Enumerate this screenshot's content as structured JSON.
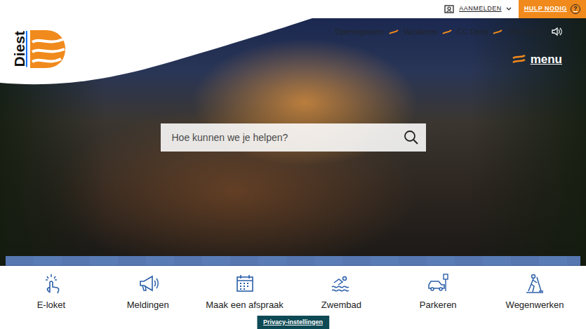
{
  "top_bar": {
    "login": "AANMELDEN",
    "help": "HULP NODIG",
    "help_icon": "?"
  },
  "logo": {
    "text": "Diest"
  },
  "header_links": [
    "Openingsuren",
    "Vacatures",
    "CC Diest",
    "Visit Diest"
  ],
  "menu": {
    "label": "menu"
  },
  "search": {
    "placeholder": "Hoe kunnen we je helpen?"
  },
  "quick_links": [
    {
      "label": "E-loket"
    },
    {
      "label": "Meldingen"
    },
    {
      "label": "Maak een afspraak"
    },
    {
      "label": "Zwembad"
    },
    {
      "label": "Parkeren"
    },
    {
      "label": "Wegenwerken"
    }
  ],
  "privacy": {
    "label": "Privacy-instellingen"
  }
}
